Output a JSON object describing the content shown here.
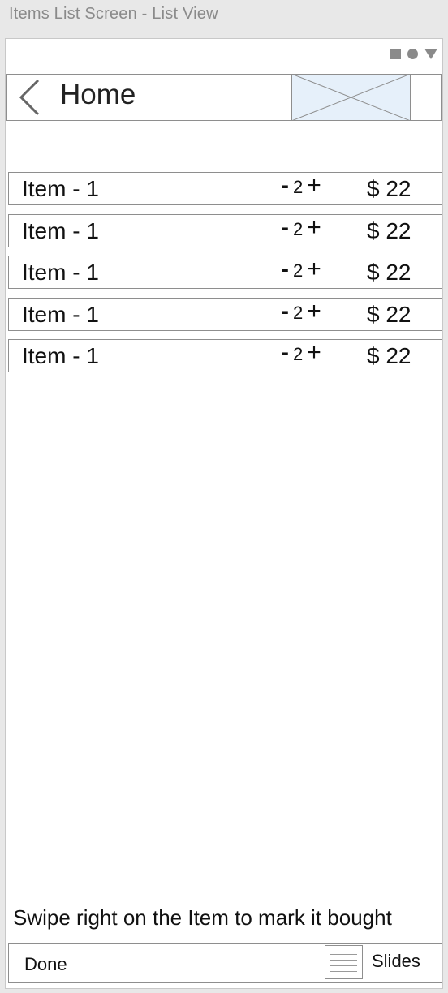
{
  "window": {
    "title": "Items List Screen - List View"
  },
  "nav": {
    "back_icon": "chevron-left-icon",
    "title": "Home",
    "image_placeholder": "image-placeholder"
  },
  "items": [
    {
      "name": "Item - 1",
      "minus": "-",
      "quantity": "2",
      "plus": "+",
      "price": "$ 22"
    },
    {
      "name": "Item - 1",
      "minus": "-",
      "quantity": "2",
      "plus": "+",
      "price": "$ 22"
    },
    {
      "name": "Item - 1",
      "minus": "-",
      "quantity": "2",
      "plus": "+",
      "price": "$ 22"
    },
    {
      "name": "Item - 1",
      "minus": "-",
      "quantity": "2",
      "plus": "+",
      "price": "$ 22"
    },
    {
      "name": "Item - 1",
      "minus": "-",
      "quantity": "2",
      "plus": "+",
      "price": "$ 22"
    }
  ],
  "hint": "Swipe right on the Item to mark it bought",
  "bottom_bar": {
    "done_label": "Done",
    "slides_icon": "slides-icon",
    "slides_label": "Slides"
  },
  "colors": {
    "border": "#8e8e8e",
    "placeholder_fill": "#e6f0fa",
    "chrome_text": "#8a8a8a",
    "chrome_background": "#e8e8e8"
  }
}
